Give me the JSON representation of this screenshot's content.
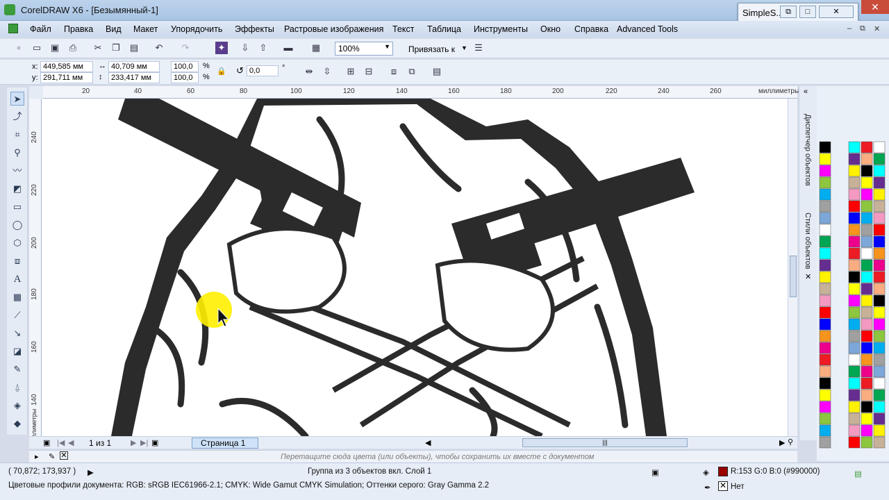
{
  "window": {
    "title": "CorelDRAW X6 - [Безымянный-1]",
    "popup_title": "SimpleS..."
  },
  "menu": {
    "items": [
      "Файл",
      "Правка",
      "Вид",
      "Макет",
      "Упорядочить",
      "Эффекты",
      "Растровые изображения",
      "Текст",
      "Таблица",
      "Инструменты",
      "Окно",
      "Справка",
      "Advanced Tools"
    ]
  },
  "toolbar": {
    "zoom": "100%",
    "snap_label": "Привязать к"
  },
  "property_bar": {
    "x_label": "x:",
    "y_label": "y:",
    "x_value": "449,585 мм",
    "y_value": "291,711 мм",
    "width_value": "40,709 мм",
    "height_value": "233,417 мм",
    "scale_x": "100,0",
    "scale_y": "100,0",
    "percent": "%",
    "rotation": "0,0",
    "degree": "°"
  },
  "rulers": {
    "units": "миллиметры",
    "h_ticks": [
      "20",
      "40",
      "60",
      "80",
      "100",
      "120",
      "140",
      "160",
      "180",
      "200",
      "220",
      "240",
      "260"
    ],
    "v_ticks": [
      "240",
      "220",
      "200",
      "180",
      "160",
      "140"
    ]
  },
  "page_nav": {
    "page_count": "1 из 1",
    "page_tab": "Страница 1"
  },
  "doc_palette": {
    "hint": "Перетащите сюда цвета (или объекты), чтобы сохранить их вместе с документом"
  },
  "dockers": {
    "tab1": "Диспетчер объектов",
    "tab2": "Стили объектов"
  },
  "status": {
    "coords": "( 70,872; 173,937 )",
    "selection": "Группа из 3 объектов вкл. Слой 1",
    "color_profiles": "Цветовые профили документа: RGB: sRGB IEC61966-2.1; CMYK: Wide Gamut CMYK Simulation; Оттенки серого: Gray Gamma 2.2",
    "fill_value": "R:153 G:0 B:0 (#990000)",
    "outline_value": "Нет",
    "fill_color": "#990000"
  },
  "palette": {
    "colors": [
      "#000000",
      "#ffffff",
      "#ff0000",
      "#ffff00",
      "#00a651",
      "#0000ff",
      "#ff00ff",
      "#00ffff",
      "#f7941d",
      "#8dc63f",
      "#662d91",
      "#ec008c",
      "#00aeef",
      "#fff200",
      "#ed1c24",
      "#a0a0a0",
      "#c7b299",
      "#f9ad81",
      "#7da7d9",
      "#f49ac1"
    ]
  },
  "illustration": {
    "description_colors": {
      "ink": "#2b2b2b",
      "highlight": "#ffef00"
    }
  }
}
